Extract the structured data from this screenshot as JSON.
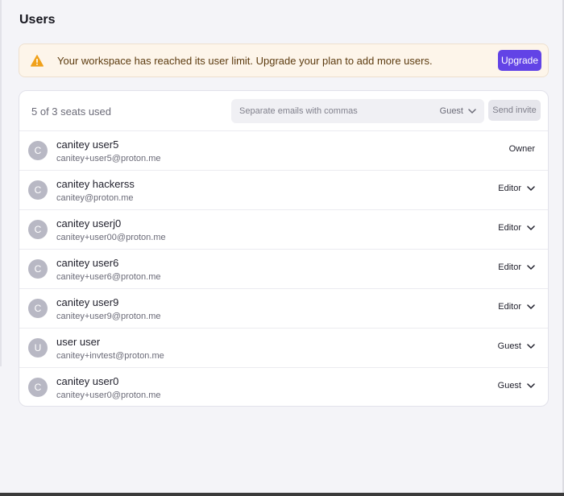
{
  "page": {
    "title": "Users"
  },
  "alert": {
    "icon": "warning-icon",
    "text": "Your workspace has reached its user limit. Upgrade your plan to add more users.",
    "button_label": "Upgrade",
    "accent_color": "#6243e6",
    "warning_color": "#f0a11a"
  },
  "invite": {
    "seats_text": "5 of 3 seats used",
    "email_placeholder": "Separate emails with commas",
    "email_value": "",
    "role_value": "Guest",
    "send_label": "Send invite"
  },
  "users": [
    {
      "initial": "C",
      "name": "canitey user5",
      "email": "canitey+user5@proton.me",
      "role": "Owner",
      "role_menu": false
    },
    {
      "initial": "C",
      "name": "canitey hackerss",
      "email": "canitey@proton.me",
      "role": "Editor",
      "role_menu": true
    },
    {
      "initial": "C",
      "name": "canitey userj0",
      "email": "canitey+user00@proton.me",
      "role": "Editor",
      "role_menu": true
    },
    {
      "initial": "C",
      "name": "canitey user6",
      "email": "canitey+user6@proton.me",
      "role": "Editor",
      "role_menu": true
    },
    {
      "initial": "C",
      "name": "canitey user9",
      "email": "canitey+user9@proton.me",
      "role": "Editor",
      "role_menu": true
    },
    {
      "initial": "U",
      "name": "user user",
      "email": "canitey+invtest@proton.me",
      "role": "Guest",
      "role_menu": true
    },
    {
      "initial": "C",
      "name": "canitey user0",
      "email": "canitey+user0@proton.me",
      "role": "Guest",
      "role_menu": true
    }
  ]
}
